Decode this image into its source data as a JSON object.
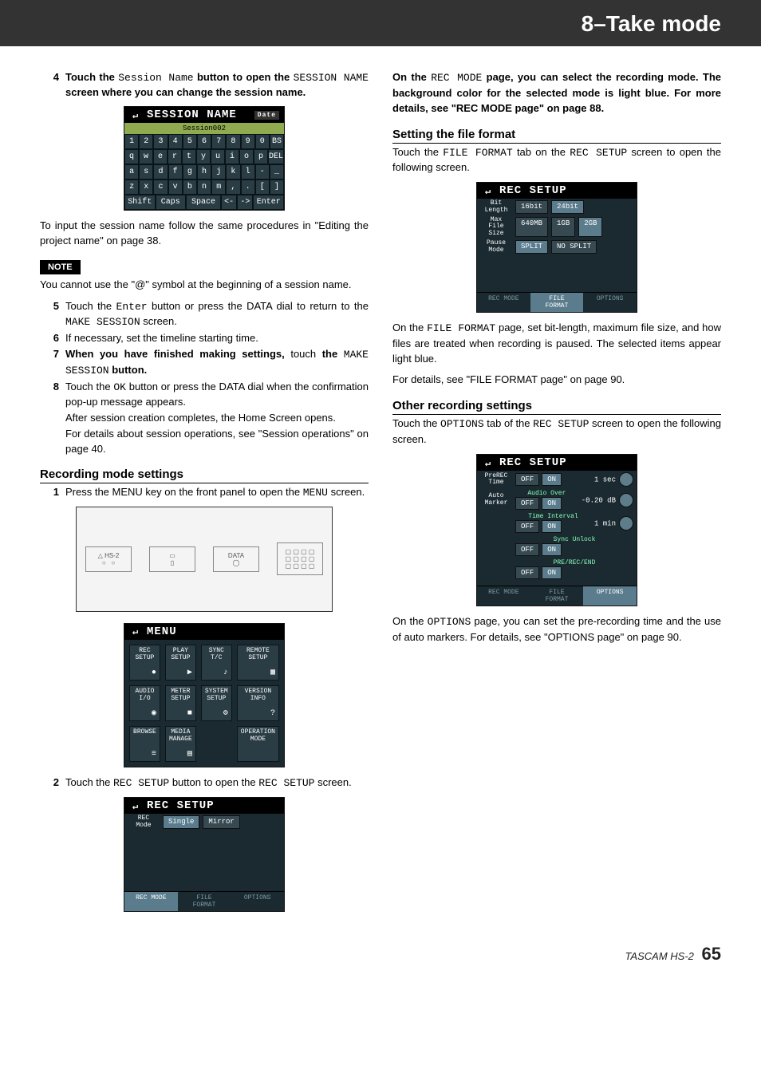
{
  "header": {
    "title": "8–Take mode"
  },
  "left": {
    "step4": {
      "num": "4",
      "t1": "Touch the ",
      "m1": "Session Name",
      "t2": " button to open the ",
      "m2": "SESSION NAME",
      "t3": " screen where you can change the session name."
    },
    "input_after": "To input the session name follow the same procedures in \"Editing the project name\" on page 38.",
    "note_label": "NOTE",
    "note_text": "You cannot use the \"@\" symbol at the beginning of a session name.",
    "step5": {
      "num": "5",
      "t1": "Touch the ",
      "m1": "Enter",
      "t2": " button or press the DATA dial to return to the ",
      "m2": "MAKE SESSION",
      "t3": " screen."
    },
    "step6": {
      "num": "6",
      "t1": "If necessary, set the timeline starting time."
    },
    "step7": {
      "num": "7",
      "t1": "When you have finished making settings,",
      "t2": " touch ",
      "t3": "the ",
      "m1": "MAKE SESSION",
      "t4": " button."
    },
    "step8": {
      "num": "8",
      "t1": "Touch the ",
      "m1": "OK",
      "t2": " button or press the DATA dial when the confirmation pop-up message appears."
    },
    "step8a": "After session creation completes, the Home Screen opens.",
    "step8b": "For details about session operations, see \"Session operations\" on page 40.",
    "sub_rec": "Recording mode settings",
    "step1": {
      "num": "1",
      "t1": "Press the MENU key on the front panel to open the ",
      "m1": "MENU",
      "t2": " screen."
    },
    "step2": {
      "num": "2",
      "t1": "Touch the ",
      "m1": "REC SETUP",
      "t2": " button to open the ",
      "m2": "REC SETUP",
      "t3": " screen."
    },
    "kb": {
      "title": "SESSION NAME",
      "badge": "Date",
      "field": "Session002",
      "rows": [
        [
          "1",
          "2",
          "3",
          "4",
          "5",
          "6",
          "7",
          "8",
          "9",
          "0",
          "BS"
        ],
        [
          "q",
          "w",
          "e",
          "r",
          "t",
          "y",
          "u",
          "i",
          "o",
          "p",
          "DEL"
        ],
        [
          "a",
          "s",
          "d",
          "f",
          "g",
          "h",
          "j",
          "k",
          "l",
          "-",
          "_"
        ],
        [
          "z",
          "x",
          "c",
          "v",
          "b",
          "n",
          "m",
          ",",
          ".",
          "[",
          "]"
        ]
      ],
      "bottom": [
        "Shift",
        "Caps",
        "Space",
        "<-",
        "->",
        "Enter"
      ]
    },
    "menu": {
      "title": "MENU",
      "cells": [
        "REC\nSETUP",
        "PLAY\nSETUP",
        "SYNC\nT/C",
        "REMOTE\nSETUP",
        "AUDIO\nI/O",
        "METER\nSETUP",
        "SYSTEM\nSETUP",
        "VERSION\nINFO",
        "BROWSE",
        "MEDIA\nMANAGE",
        "",
        "OPERATION\nMODE"
      ]
    },
    "recsetup1": {
      "title": "REC SETUP",
      "lab": "REC\nMode",
      "opts": [
        "Single",
        "Mirror"
      ],
      "tabs": [
        "REC MODE",
        "FILE\nFORMAT",
        "OPTIONS"
      ]
    }
  },
  "right": {
    "intro": {
      "t1": "On the ",
      "m1": "REC MODE",
      "t2": " page, you can select the recording mode. The background color for the selected mode is light blue. For more details, see \"REC MODE page\" on page 88."
    },
    "sub_file": "Setting the file format",
    "file_p": {
      "t1": "Touch the ",
      "m1": "FILE FORMAT",
      "t2": " tab on the ",
      "m2": "REC SETUP",
      "t3": " screen to open the following screen."
    },
    "file_after1": {
      "t1": "On the ",
      "m1": "FILE FORMAT",
      "t2": " page, set bit-length, maximum file size, and how files are treated when recording is paused. The selected items appear light blue."
    },
    "file_after2": "For details, see \"FILE FORMAT page\" on page 90.",
    "sub_other": "Other recording settings",
    "other_p": {
      "t1": "Touch the ",
      "m1": "OPTIONS",
      "t2": " tab of the ",
      "m2": "REC SETUP",
      "t3": " screen to open the following screen."
    },
    "other_after": {
      "t1": "On the ",
      "m1": "OPTIONS",
      "t2": " page, you can set the pre-recording time and the use of auto markers. For details, see \"OPTIONS page\" on page 90."
    },
    "recsetup2": {
      "title": "REC SETUP",
      "rows": [
        {
          "lab": "Bit\nLength",
          "opts": [
            "16bit",
            "24bit"
          ],
          "sel": 1
        },
        {
          "lab": "Max\nFile\nSize",
          "opts": [
            "640MB",
            "1GB",
            "2GB"
          ],
          "sel": 2
        },
        {
          "lab": "Pause\nMode",
          "opts": [
            "SPLIT",
            "NO SPLIT"
          ],
          "sel": 0
        }
      ],
      "tabs": [
        "REC MODE",
        "FILE\nFORMAT",
        "OPTIONS"
      ],
      "active": 1
    },
    "recsetup3": {
      "title": "REC SETUP",
      "rows": [
        {
          "lab": "PreREC\nTime",
          "opts": [
            "OFF",
            "ON"
          ],
          "val": "1 sec"
        },
        {
          "lab": "Auto\nMarker",
          "head": "Audio Over",
          "opts": [
            "OFF",
            "ON"
          ],
          "val": "-0.20 dB"
        },
        {
          "lab": "",
          "head": "Time Interval",
          "opts": [
            "OFF",
            "ON"
          ],
          "val": "1 min"
        },
        {
          "lab": "",
          "head": "Sync Unlock",
          "opts": [
            "OFF",
            "ON"
          ]
        },
        {
          "lab": "",
          "head": "PRE/REC/END",
          "opts": [
            "OFF",
            "ON"
          ]
        }
      ],
      "tabs": [
        "REC MODE",
        "FILE\nFORMAT",
        "OPTIONS"
      ],
      "active": 2
    }
  },
  "footer": {
    "model": "TASCAM HS-2",
    "page": "65"
  }
}
